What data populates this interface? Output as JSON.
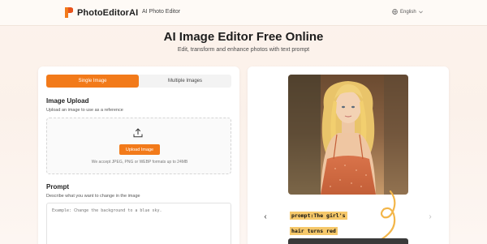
{
  "header": {
    "brand": "PhotoEditorAI",
    "nav_link": "AI Photo Editor",
    "language": "English"
  },
  "hero": {
    "title": "AI Image Editor Free Online",
    "subtitle": "Edit, transform and enhance photos with text prompt"
  },
  "editor": {
    "tabs": [
      {
        "label": "Single Image",
        "active": true
      },
      {
        "label": "Multiple Images",
        "active": false
      }
    ],
    "upload": {
      "title": "Image Upload",
      "description": "Upload an image to use as a reference",
      "button_label": "Upload Image",
      "note": "We accept JPEG, PNG or WEBP formats up to 24MB"
    },
    "prompt": {
      "title": "Prompt",
      "description": "Describe what you want to change in the image",
      "placeholder": "Example: Change the background to a blue sky."
    }
  },
  "preview": {
    "caption_lines": [
      "prompt:The girl's",
      "hair turns red"
    ],
    "prev_icon": "chevron-left-icon",
    "next_icon": "chevron-right-icon"
  },
  "colors": {
    "accent": "#f27a1a",
    "caption_highlight": "#f6c86a"
  }
}
